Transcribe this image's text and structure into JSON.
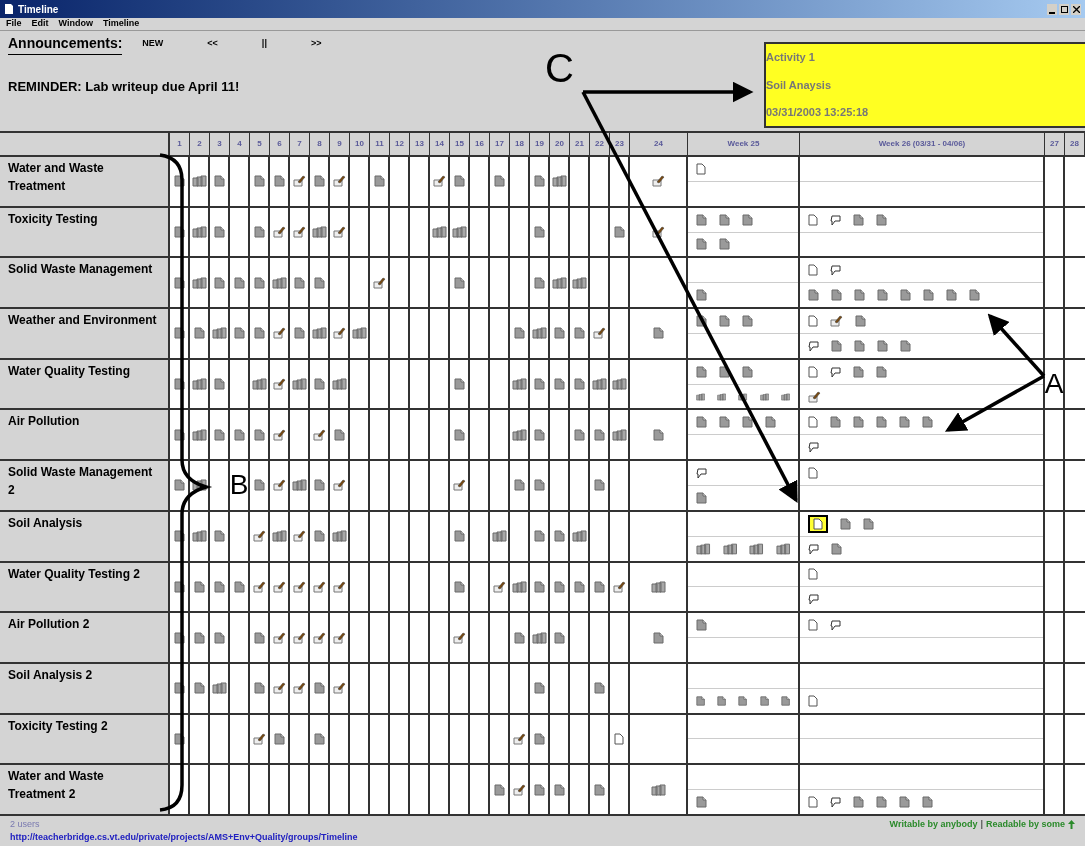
{
  "window": {
    "title": "Timeline"
  },
  "menu": [
    "File",
    "Edit",
    "Window",
    "Timeline"
  ],
  "announcements": {
    "label": "Announcements:",
    "controls": [
      "NEW",
      "<<",
      "||",
      ">>"
    ],
    "message": "REMINDER: Lab writeup due April 11!"
  },
  "popup": {
    "lines": [
      "Activity 1",
      "Soil Anaysis",
      "03/31/2003 13:25:18"
    ]
  },
  "columns": [
    "1",
    "2",
    "3",
    "4",
    "5",
    "6",
    "7",
    "8",
    "9",
    "10",
    "11",
    "12",
    "13",
    "14",
    "15",
    "16",
    "17",
    "18",
    "19",
    "20",
    "21",
    "22",
    "23",
    "24",
    "Week 25",
    "Week 26 (03/31 - 04/06)",
    "27",
    "28"
  ],
  "rows": [
    {
      "name": "Water and Waste Treatment",
      "days": [
        {
          "kind": "doc"
        },
        {
          "kind": "multi"
        },
        {
          "kind": "doc"
        },
        {
          "kind": "none"
        },
        {
          "kind": "doc"
        },
        {
          "kind": "doc"
        },
        {
          "kind": "edit"
        },
        {
          "kind": "doc"
        },
        {
          "kind": "edit"
        },
        {
          "kind": "none"
        },
        {
          "kind": "doc"
        },
        {
          "kind": "none"
        },
        {
          "kind": "none"
        },
        {
          "kind": "edit"
        },
        {
          "kind": "doc"
        },
        {
          "kind": "none"
        },
        {
          "kind": "doc"
        },
        {
          "kind": "none"
        },
        {
          "kind": "doc"
        },
        {
          "kind": "multi"
        },
        {
          "kind": "none"
        },
        {
          "kind": "none"
        },
        {
          "kind": "none"
        },
        {
          "kind": "edit"
        }
      ],
      "week25": {
        "top": [
          {
            "kind": "page"
          }
        ]
      },
      "week26": {}
    },
    {
      "name": "Toxicity Testing",
      "days": [
        {
          "kind": "doc"
        },
        {
          "kind": "multi"
        },
        {
          "kind": "doc"
        },
        {
          "kind": "none"
        },
        {
          "kind": "doc"
        },
        {
          "kind": "edit"
        },
        {
          "kind": "edit"
        },
        {
          "kind": "multi"
        },
        {
          "kind": "edit"
        },
        {
          "kind": "none"
        },
        {
          "kind": "none"
        },
        {
          "kind": "none"
        },
        {
          "kind": "none"
        },
        {
          "kind": "multi"
        },
        {
          "kind": "multi"
        },
        {
          "kind": "none"
        },
        {
          "kind": "none"
        },
        {
          "kind": "none"
        },
        {
          "kind": "doc"
        },
        {
          "kind": "none"
        },
        {
          "kind": "none"
        },
        {
          "kind": "none"
        },
        {
          "kind": "doc"
        },
        {
          "kind": "edit"
        }
      ],
      "week25": {
        "top": [
          {
            "kind": "doc"
          },
          {
            "kind": "doc"
          },
          {
            "kind": "doc"
          }
        ],
        "bottom": [
          {
            "kind": "doc"
          },
          {
            "kind": "doc"
          }
        ]
      },
      "week26": {
        "top": [
          {
            "kind": "page"
          },
          {
            "kind": "bubble"
          },
          {
            "kind": "doc"
          },
          {
            "kind": "doc"
          }
        ]
      }
    },
    {
      "name": "Solid Waste Management",
      "days": [
        {
          "kind": "doc"
        },
        {
          "kind": "multi"
        },
        {
          "kind": "doc"
        },
        {
          "kind": "doc"
        },
        {
          "kind": "doc"
        },
        {
          "kind": "multi"
        },
        {
          "kind": "doc"
        },
        {
          "kind": "doc"
        },
        {
          "kind": "none"
        },
        {
          "kind": "none"
        },
        {
          "kind": "edit"
        },
        {
          "kind": "none"
        },
        {
          "kind": "none"
        },
        {
          "kind": "none"
        },
        {
          "kind": "doc"
        },
        {
          "kind": "none"
        },
        {
          "kind": "none"
        },
        {
          "kind": "none"
        },
        {
          "kind": "doc"
        },
        {
          "kind": "multi"
        },
        {
          "kind": "multi"
        },
        {
          "kind": "none"
        },
        {
          "kind": "none"
        },
        {
          "kind": "none"
        }
      ],
      "week25": {
        "bottom": [
          {
            "kind": "doc"
          }
        ]
      },
      "week26": {
        "top": [
          {
            "kind": "page"
          },
          {
            "kind": "bubble"
          }
        ],
        "bottom": [
          {
            "kind": "doc"
          },
          {
            "kind": "doc"
          },
          {
            "kind": "doc"
          },
          {
            "kind": "doc"
          },
          {
            "kind": "doc"
          },
          {
            "kind": "doc"
          },
          {
            "kind": "doc"
          },
          {
            "kind": "doc"
          }
        ]
      }
    },
    {
      "name": "Weather and Environment",
      "days": [
        {
          "kind": "doc"
        },
        {
          "kind": "doc"
        },
        {
          "kind": "multi"
        },
        {
          "kind": "doc"
        },
        {
          "kind": "doc"
        },
        {
          "kind": "edit"
        },
        {
          "kind": "doc"
        },
        {
          "kind": "multi"
        },
        {
          "kind": "edit"
        },
        {
          "kind": "multi"
        },
        {
          "kind": "none"
        },
        {
          "kind": "none"
        },
        {
          "kind": "none"
        },
        {
          "kind": "none"
        },
        {
          "kind": "none"
        },
        {
          "kind": "none"
        },
        {
          "kind": "none"
        },
        {
          "kind": "doc"
        },
        {
          "kind": "multi"
        },
        {
          "kind": "doc"
        },
        {
          "kind": "doc"
        },
        {
          "kind": "edit"
        },
        {
          "kind": "none"
        },
        {
          "kind": "doc"
        }
      ],
      "week25": {
        "top": [
          {
            "kind": "doc"
          },
          {
            "kind": "doc"
          },
          {
            "kind": "doc"
          }
        ]
      },
      "week26": {
        "top": [
          {
            "kind": "page"
          },
          {
            "kind": "edit"
          },
          {
            "kind": "doc"
          }
        ],
        "bottom": [
          {
            "kind": "bubble"
          },
          {
            "kind": "doc"
          },
          {
            "kind": "doc"
          },
          {
            "kind": "doc"
          },
          {
            "kind": "doc"
          }
        ]
      }
    },
    {
      "name": "Water Quality Testing",
      "days": [
        {
          "kind": "doc"
        },
        {
          "kind": "multi"
        },
        {
          "kind": "doc"
        },
        {
          "kind": "none"
        },
        {
          "kind": "multi"
        },
        {
          "kind": "edit"
        },
        {
          "kind": "multi"
        },
        {
          "kind": "doc"
        },
        {
          "kind": "multi"
        },
        {
          "kind": "none"
        },
        {
          "kind": "none"
        },
        {
          "kind": "none"
        },
        {
          "kind": "none"
        },
        {
          "kind": "none"
        },
        {
          "kind": "doc"
        },
        {
          "kind": "none"
        },
        {
          "kind": "none"
        },
        {
          "kind": "multi"
        },
        {
          "kind": "doc"
        },
        {
          "kind": "doc"
        },
        {
          "kind": "doc"
        },
        {
          "kind": "multi"
        },
        {
          "kind": "multi"
        },
        {
          "kind": "none"
        }
      ],
      "week25": {
        "top": [
          {
            "kind": "doc"
          },
          {
            "kind": "doc"
          },
          {
            "kind": "doc"
          }
        ],
        "bottom": [
          {
            "kind": "multi"
          },
          {
            "kind": "multi"
          },
          {
            "kind": "multi"
          },
          {
            "kind": "multi"
          },
          {
            "kind": "multi"
          }
        ]
      },
      "week26": {
        "top": [
          {
            "kind": "page"
          },
          {
            "kind": "bubble"
          },
          {
            "kind": "doc"
          },
          {
            "kind": "doc"
          }
        ],
        "bottom": [
          {
            "kind": "edit"
          }
        ]
      }
    },
    {
      "name": "Air Pollution",
      "days": [
        {
          "kind": "doc"
        },
        {
          "kind": "multi"
        },
        {
          "kind": "doc"
        },
        {
          "kind": "doc"
        },
        {
          "kind": "doc"
        },
        {
          "kind": "edit"
        },
        {
          "kind": "none"
        },
        {
          "kind": "edit"
        },
        {
          "kind": "doc"
        },
        {
          "kind": "none"
        },
        {
          "kind": "none"
        },
        {
          "kind": "none"
        },
        {
          "kind": "none"
        },
        {
          "kind": "none"
        },
        {
          "kind": "doc"
        },
        {
          "kind": "none"
        },
        {
          "kind": "none"
        },
        {
          "kind": "multi"
        },
        {
          "kind": "doc"
        },
        {
          "kind": "none"
        },
        {
          "kind": "doc"
        },
        {
          "kind": "doc"
        },
        {
          "kind": "multi"
        },
        {
          "kind": "doc"
        }
      ],
      "week25": {
        "top": [
          {
            "kind": "doc"
          },
          {
            "kind": "doc"
          },
          {
            "kind": "doc"
          },
          {
            "kind": "doc"
          }
        ]
      },
      "week26": {
        "top": [
          {
            "kind": "page"
          },
          {
            "kind": "doc"
          },
          {
            "kind": "doc"
          },
          {
            "kind": "doc"
          },
          {
            "kind": "doc"
          },
          {
            "kind": "doc"
          }
        ],
        "bottom": [
          {
            "kind": "bubble"
          }
        ]
      }
    },
    {
      "name": "Solid Waste Management 2",
      "days": [
        {
          "kind": "doc"
        },
        {
          "kind": "multi"
        },
        {
          "kind": "none"
        },
        {
          "kind": "none"
        },
        {
          "kind": "doc"
        },
        {
          "kind": "edit"
        },
        {
          "kind": "multi"
        },
        {
          "kind": "doc"
        },
        {
          "kind": "edit"
        },
        {
          "kind": "none"
        },
        {
          "kind": "none"
        },
        {
          "kind": "none"
        },
        {
          "kind": "none"
        },
        {
          "kind": "none"
        },
        {
          "kind": "edit"
        },
        {
          "kind": "none"
        },
        {
          "kind": "none"
        },
        {
          "kind": "doc"
        },
        {
          "kind": "doc"
        },
        {
          "kind": "none"
        },
        {
          "kind": "none"
        },
        {
          "kind": "doc"
        },
        {
          "kind": "none"
        },
        {
          "kind": "none"
        }
      ],
      "week25": {
        "top": [
          {
            "kind": "bubble"
          }
        ],
        "bottom": [
          {
            "kind": "doc"
          }
        ]
      },
      "week26": {
        "top": [
          {
            "kind": "page"
          }
        ]
      }
    },
    {
      "name": "Soil Analysis",
      "days": [
        {
          "kind": "doc"
        },
        {
          "kind": "multi"
        },
        {
          "kind": "doc"
        },
        {
          "kind": "none"
        },
        {
          "kind": "edit"
        },
        {
          "kind": "multi"
        },
        {
          "kind": "edit"
        },
        {
          "kind": "doc"
        },
        {
          "kind": "multi"
        },
        {
          "kind": "none"
        },
        {
          "kind": "none"
        },
        {
          "kind": "none"
        },
        {
          "kind": "none"
        },
        {
          "kind": "none"
        },
        {
          "kind": "doc"
        },
        {
          "kind": "none"
        },
        {
          "kind": "multi"
        },
        {
          "kind": "none"
        },
        {
          "kind": "doc"
        },
        {
          "kind": "doc"
        },
        {
          "kind": "multi"
        },
        {
          "kind": "none"
        },
        {
          "kind": "none"
        },
        {
          "kind": "none"
        }
      ],
      "week25": {
        "bottom": [
          {
            "kind": "multi"
          },
          {
            "kind": "multi"
          },
          {
            "kind": "multi"
          },
          {
            "kind": "multi"
          }
        ]
      },
      "week26": {
        "top": [
          {
            "kind": "picked"
          },
          {
            "kind": "doc"
          },
          {
            "kind": "doc"
          }
        ],
        "bottom": [
          {
            "kind": "bubble"
          },
          {
            "kind": "doc"
          }
        ]
      }
    },
    {
      "name": "Water Quality Testing 2",
      "days": [
        {
          "kind": "doc"
        },
        {
          "kind": "doc"
        },
        {
          "kind": "doc"
        },
        {
          "kind": "doc"
        },
        {
          "kind": "edit"
        },
        {
          "kind": "edit"
        },
        {
          "kind": "edit"
        },
        {
          "kind": "edit"
        },
        {
          "kind": "edit"
        },
        {
          "kind": "none"
        },
        {
          "kind": "none"
        },
        {
          "kind": "none"
        },
        {
          "kind": "none"
        },
        {
          "kind": "none"
        },
        {
          "kind": "doc"
        },
        {
          "kind": "none"
        },
        {
          "kind": "edit"
        },
        {
          "kind": "multi"
        },
        {
          "kind": "doc"
        },
        {
          "kind": "doc"
        },
        {
          "kind": "doc"
        },
        {
          "kind": "doc"
        },
        {
          "kind": "edit"
        },
        {
          "kind": "multi"
        }
      ],
      "week25": {},
      "week26": {
        "top": [
          {
            "kind": "page"
          }
        ],
        "bottom": [
          {
            "kind": "bubble"
          }
        ]
      }
    },
    {
      "name": "Air Pollution 2",
      "days": [
        {
          "kind": "doc"
        },
        {
          "kind": "doc"
        },
        {
          "kind": "doc"
        },
        {
          "kind": "none"
        },
        {
          "kind": "doc"
        },
        {
          "kind": "edit"
        },
        {
          "kind": "edit"
        },
        {
          "kind": "edit"
        },
        {
          "kind": "edit"
        },
        {
          "kind": "none"
        },
        {
          "kind": "none"
        },
        {
          "kind": "none"
        },
        {
          "kind": "none"
        },
        {
          "kind": "none"
        },
        {
          "kind": "edit"
        },
        {
          "kind": "none"
        },
        {
          "kind": "none"
        },
        {
          "kind": "doc"
        },
        {
          "kind": "multi"
        },
        {
          "kind": "doc"
        },
        {
          "kind": "none"
        },
        {
          "kind": "none"
        },
        {
          "kind": "none"
        },
        {
          "kind": "doc"
        }
      ],
      "week25": {
        "top": [
          {
            "kind": "doc"
          }
        ]
      },
      "week26": {
        "top": [
          {
            "kind": "page"
          },
          {
            "kind": "bubble"
          }
        ]
      }
    },
    {
      "name": "Soil Analysis 2",
      "days": [
        {
          "kind": "doc"
        },
        {
          "kind": "doc"
        },
        {
          "kind": "multi"
        },
        {
          "kind": "none"
        },
        {
          "kind": "doc"
        },
        {
          "kind": "edit"
        },
        {
          "kind": "edit"
        },
        {
          "kind": "doc"
        },
        {
          "kind": "edit"
        },
        {
          "kind": "none"
        },
        {
          "kind": "none"
        },
        {
          "kind": "none"
        },
        {
          "kind": "none"
        },
        {
          "kind": "none"
        },
        {
          "kind": "none"
        },
        {
          "kind": "none"
        },
        {
          "kind": "none"
        },
        {
          "kind": "none"
        },
        {
          "kind": "doc"
        },
        {
          "kind": "none"
        },
        {
          "kind": "none"
        },
        {
          "kind": "doc"
        },
        {
          "kind": "none"
        },
        {
          "kind": "none"
        }
      ],
      "week25": {
        "bottom": [
          {
            "kind": "doc"
          },
          {
            "kind": "doc"
          },
          {
            "kind": "doc"
          },
          {
            "kind": "doc"
          },
          {
            "kind": "doc"
          }
        ]
      },
      "week26": {
        "bottom": [
          {
            "kind": "page"
          }
        ]
      }
    },
    {
      "name": "Toxicity Testing 2",
      "days": [
        {
          "kind": "doc"
        },
        {
          "kind": "none"
        },
        {
          "kind": "none"
        },
        {
          "kind": "none"
        },
        {
          "kind": "edit"
        },
        {
          "kind": "doc"
        },
        {
          "kind": "none"
        },
        {
          "kind": "doc"
        },
        {
          "kind": "none"
        },
        {
          "kind": "none"
        },
        {
          "kind": "none"
        },
        {
          "kind": "none"
        },
        {
          "kind": "none"
        },
        {
          "kind": "none"
        },
        {
          "kind": "none"
        },
        {
          "kind": "none"
        },
        {
          "kind": "none"
        },
        {
          "kind": "edit"
        },
        {
          "kind": "doc"
        },
        {
          "kind": "none"
        },
        {
          "kind": "none"
        },
        {
          "kind": "none"
        },
        {
          "kind": "page"
        },
        {
          "kind": "none"
        }
      ],
      "week25": {},
      "week26": {}
    },
    {
      "name": "Water and Waste Treatment 2",
      "days": [
        {
          "kind": "none"
        },
        {
          "kind": "none"
        },
        {
          "kind": "none"
        },
        {
          "kind": "none"
        },
        {
          "kind": "none"
        },
        {
          "kind": "none"
        },
        {
          "kind": "none"
        },
        {
          "kind": "none"
        },
        {
          "kind": "none"
        },
        {
          "kind": "none"
        },
        {
          "kind": "none"
        },
        {
          "kind": "none"
        },
        {
          "kind": "none"
        },
        {
          "kind": "none"
        },
        {
          "kind": "none"
        },
        {
          "kind": "none"
        },
        {
          "kind": "doc"
        },
        {
          "kind": "edit"
        },
        {
          "kind": "doc"
        },
        {
          "kind": "doc"
        },
        {
          "kind": "none"
        },
        {
          "kind": "doc"
        },
        {
          "kind": "none"
        },
        {
          "kind": "multi"
        }
      ],
      "week25": {
        "bottom": [
          {
            "kind": "doc"
          }
        ]
      },
      "week26": {
        "bottom": [
          {
            "kind": "page"
          },
          {
            "kind": "bubble"
          },
          {
            "kind": "doc"
          },
          {
            "kind": "doc"
          },
          {
            "kind": "doc"
          },
          {
            "kind": "doc"
          }
        ]
      }
    }
  ],
  "status_bar": {
    "users": "2 users",
    "url": "http://teacherbridge.cs.vt.edu/private/projects/AMS+Env+Quality/groups/Timeline",
    "writable": "Writable by anybody",
    "separator": "|",
    "readable": "Readable by some"
  },
  "annotations": [
    "C",
    "A",
    "B"
  ]
}
